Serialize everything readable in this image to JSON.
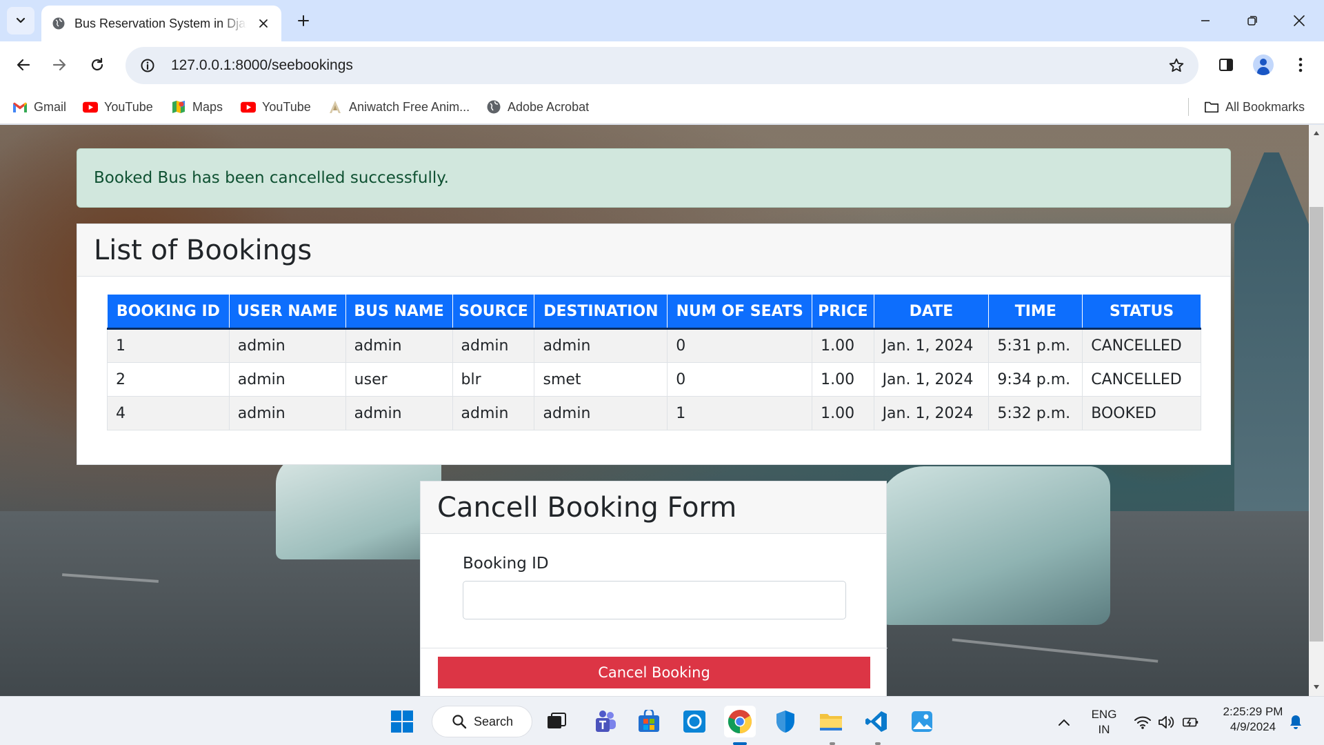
{
  "browser": {
    "tab_title": "Bus Reservation System in Django",
    "url": "127.0.0.1:8000/seebookings",
    "bookmarks": [
      {
        "label": "Gmail",
        "icon": "gmail-icon"
      },
      {
        "label": "YouTube",
        "icon": "youtube-icon"
      },
      {
        "label": "Maps",
        "icon": "maps-icon"
      },
      {
        "label": "YouTube",
        "icon": "youtube-icon"
      },
      {
        "label": "Aniwatch Free Anim...",
        "icon": "aniwatch-icon"
      },
      {
        "label": "Adobe Acrobat",
        "icon": "globe-icon"
      }
    ],
    "all_bookmarks_label": "All Bookmarks"
  },
  "page": {
    "alert_message": "Booked Bus has been cancelled successfully.",
    "bookings_title": "List of Bookings",
    "table": {
      "headers": [
        "BOOKING ID",
        "USER NAME",
        "BUS NAME",
        "SOURCE",
        "DESTINATION",
        "NUM OF SEATS",
        "PRICE",
        "DATE",
        "TIME",
        "STATUS"
      ],
      "rows": [
        [
          "1",
          "admin",
          "admin",
          "admin",
          "admin",
          "0",
          "1.00",
          "Jan. 1, 2024",
          "5:31 p.m.",
          "CANCELLED"
        ],
        [
          "2",
          "admin",
          "user",
          "blr",
          "smet",
          "0",
          "1.00",
          "Jan. 1, 2024",
          "9:34 p.m.",
          "CANCELLED"
        ],
        [
          "4",
          "admin",
          "admin",
          "admin",
          "admin",
          "1",
          "1.00",
          "Jan. 1, 2024",
          "5:32 p.m.",
          "BOOKED"
        ]
      ]
    },
    "form": {
      "title": "Cancell Booking Form",
      "field_label": "Booking ID",
      "field_value": "",
      "submit_label": "Cancel Booking"
    }
  },
  "taskbar": {
    "search_label": "Search",
    "language_line1": "ENG",
    "language_line2": "IN",
    "time": "2:25:29 PM",
    "date": "4/9/2024"
  },
  "colors": {
    "primary": "#0d6efd",
    "danger": "#dc3545",
    "success_bg": "#d1e7dd",
    "success_text": "#0f5132"
  }
}
